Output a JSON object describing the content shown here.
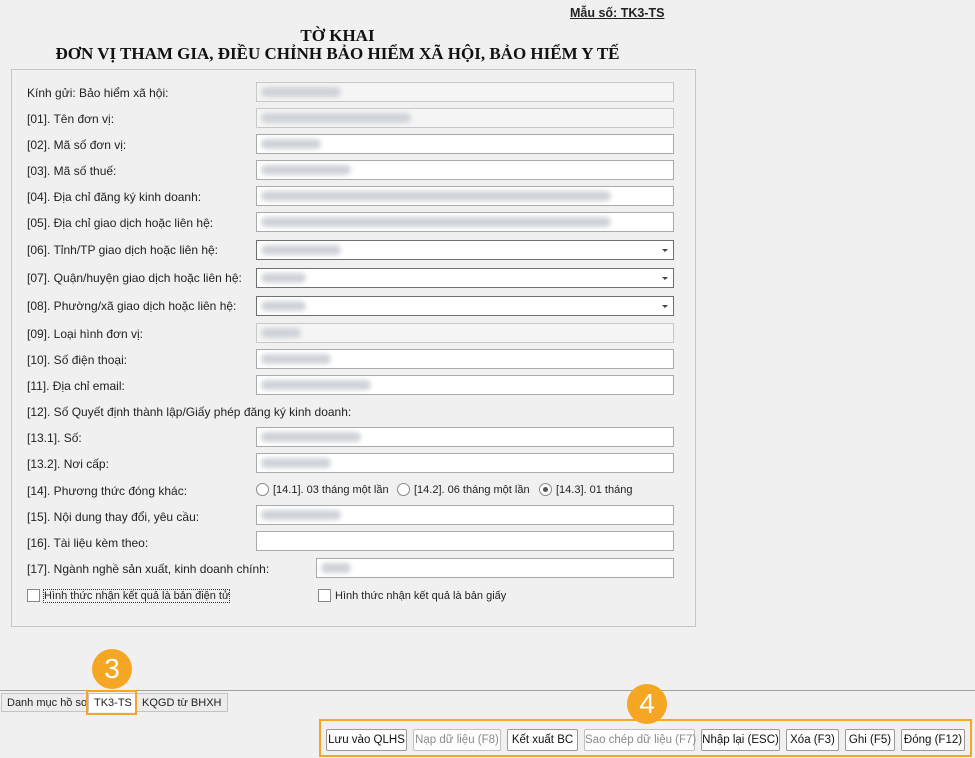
{
  "header": {
    "form_code": "Mẫu số: TK3-TS",
    "title1": "TỜ KHAI",
    "title2": "ĐƠN VỊ THAM GIA, ĐIỀU CHỈNH BẢO HIỂM XÃ HỘI, BẢO HIỂM Y TẾ"
  },
  "form": {
    "kinh_gui": "Kính gửi: Bảo hiểm xã hội:",
    "f01": "[01]. Tên đơn vị:",
    "f02": "[02]. Mã số đơn vị:",
    "f03": "[03]. Mã số thuế:",
    "f04": "[04]. Địa chỉ đăng ký kinh doanh:",
    "f05": "[05]. Địa chỉ giao dịch hoặc liên hệ:",
    "f06": "[06]. Tỉnh/TP giao dịch hoặc liên hệ:",
    "f07": "[07]. Quận/huyện giao dịch hoặc liên hệ:",
    "f08": "[08]. Phường/xã giao dịch hoặc liên hệ:",
    "f09": "[09]. Loại hình đơn vị:",
    "f10": "[10]. Số điện thoại:",
    "f11": "[11]. Địa chỉ email:",
    "f12": "[12]. Số Quyết định thành lập/Giấy phép đăng ký kinh doanh:",
    "f13_1": "[13.1]. Số:",
    "f13_2": "[13.2]. Nơi cấp:",
    "f14": "[14]. Phương thức đóng khác:",
    "f15": "[15]. Nội dung thay đổi, yêu cầu:",
    "f16": "[16]. Tài liệu kèm theo:",
    "f17": "[17]. Ngành nghề sản xuất, kinh doanh chính:",
    "radio_options": [
      "[14.1]. 03 tháng một lần",
      "[14.2]. 06 tháng một lần",
      "[14.3]. 01 tháng"
    ],
    "selected_radio": "[14.3]. 01 tháng",
    "cb_electronic": "Hình thức nhận kết quả là bản điện tử",
    "cb_paper": "Hình thức nhận kết quả là bản giấy"
  },
  "tabs": [
    "Danh mục hồ sơ",
    "TK3-TS",
    "KQGD từ BHXH"
  ],
  "active_tab": "TK3-TS",
  "badges": {
    "tab_marker": "3",
    "buttons_marker": "4"
  },
  "buttons": {
    "luu": "Lưu vào QLHS",
    "nap": "Nạp dữ liệu (F8)",
    "ketxuat": "Kết xuất BC",
    "saochep": "Sao chép dữ liệu (F7)",
    "nhaplai": "Nhập lại (ESC)",
    "xoa": "Xóa (F3)",
    "ghi": "Ghi (F5)",
    "dong": "Đóng (F12)"
  },
  "colors": {
    "accent": "#f5a623"
  }
}
